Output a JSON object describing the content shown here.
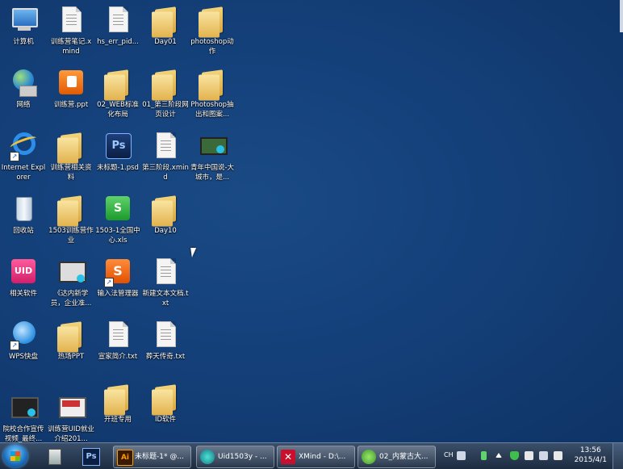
{
  "desktop_icons": [
    {
      "label": "计算机"
    },
    {
      "label": "训练营笔记.xmind"
    },
    {
      "label": "hs_err_pid..."
    },
    {
      "label": "Day01"
    },
    {
      "label": "photoshop动作"
    },
    {
      "label": "网络"
    },
    {
      "label": "训练营.ppt"
    },
    {
      "label": "02_WEB标准化布局"
    },
    {
      "label": "01_第三阶段网页设计"
    },
    {
      "label": "Photoshop抽出和图案..."
    },
    {
      "label": "Internet Explorer"
    },
    {
      "label": "训练营相关资料"
    },
    {
      "label": "未标题-1.psd"
    },
    {
      "label": "第三阶段.xmind"
    },
    {
      "label": "青年中国说-大城市，是..."
    },
    {
      "label": "回收站"
    },
    {
      "label": "1503训练营作业"
    },
    {
      "label": "1503-1全国中心.xls"
    },
    {
      "label": "Day10"
    },
    {
      "label": "相关软件"
    },
    {
      "label": "《达内新学员，企业准..."
    },
    {
      "label": "输入法管理器"
    },
    {
      "label": "新建文本文档.txt"
    },
    {
      "label": "WPS快盘"
    },
    {
      "label": "热场PPT"
    },
    {
      "label": "宣家简介.txt"
    },
    {
      "label": "葬天传奇.txt"
    },
    {
      "label": "院校合作宣传视频_最终..."
    },
    {
      "label": "训练营UID就业介绍201..."
    },
    {
      "label": "开班专用"
    },
    {
      "label": "ID软件"
    }
  ],
  "taskbar": {
    "pinned": [
      "Windows Explorer",
      "Photoshop"
    ],
    "pinned_ps_text": "Ps",
    "tasks": [
      {
        "label": "未标题-1* @...",
        "icon_text": "Ai"
      },
      {
        "label": "Uid1503y - ..."
      },
      {
        "label": "XMind - D:\\..."
      },
      {
        "label": "02_内蒙古大..."
      }
    ],
    "tray": {
      "lang": "CH"
    },
    "clock": {
      "time": "13:56",
      "date": "2015/4/1"
    }
  },
  "colors": {
    "desktop": "#14407a",
    "taskbar": "#2a3a52",
    "folder": "#e8bf5c"
  }
}
